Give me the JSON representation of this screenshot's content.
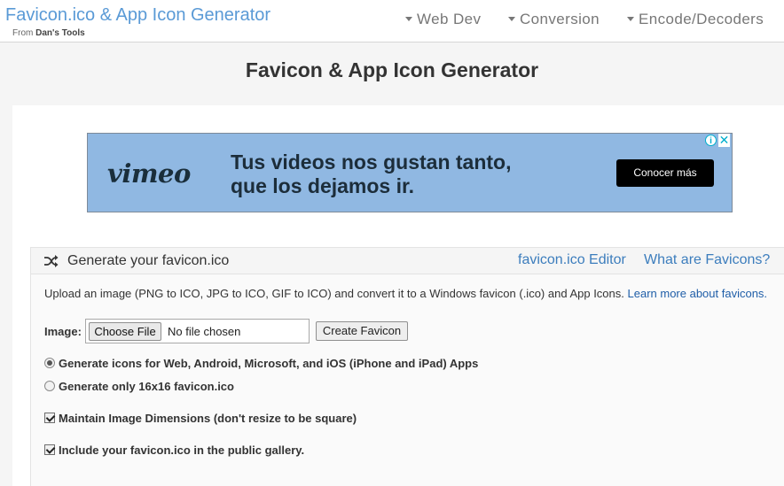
{
  "header": {
    "brand_title": "Favicon.ico & App Icon Generator",
    "brand_sub_prefix": "From",
    "brand_sub_name": "Dan's Tools",
    "nav": [
      "Web Dev",
      "Conversion",
      "Encode/Decoders"
    ]
  },
  "page": {
    "title": "Favicon & App Icon Generator"
  },
  "ad": {
    "logo": "vimeo",
    "line1": "Tus videos nos gustan tanto,",
    "line2": "que los dejamos ir.",
    "cta": "Conocer más",
    "info_glyph": "i",
    "close_glyph": "✕"
  },
  "generator": {
    "title": "Generate your favicon.ico",
    "links": [
      "favicon.ico Editor",
      "What are Favicons?"
    ],
    "description": "Upload an image (PNG to ICO, JPG to ICO, GIF to ICO) and convert it to a Windows favicon (.ico) and App Icons. ",
    "learn_more": "Learn more about favicons.",
    "image_label": "Image:",
    "choose_file": "Choose File",
    "no_file": "No file chosen",
    "create_button": "Create Favicon",
    "radio_options": [
      {
        "label": "Generate icons for Web, Android, Microsoft, and iOS (iPhone and iPad) Apps",
        "checked": true
      },
      {
        "label": "Generate only 16x16 favicon.ico",
        "checked": false
      }
    ],
    "checkboxes": [
      {
        "label": "Maintain Image Dimensions (don't resize to be square)",
        "checked": true
      },
      {
        "label": "Include your favicon.ico in the public gallery.",
        "checked": true
      }
    ]
  },
  "colors": {
    "brand": "#5a9ad6",
    "link": "#3c7dbd",
    "ad_bg": "#90b8e2"
  }
}
